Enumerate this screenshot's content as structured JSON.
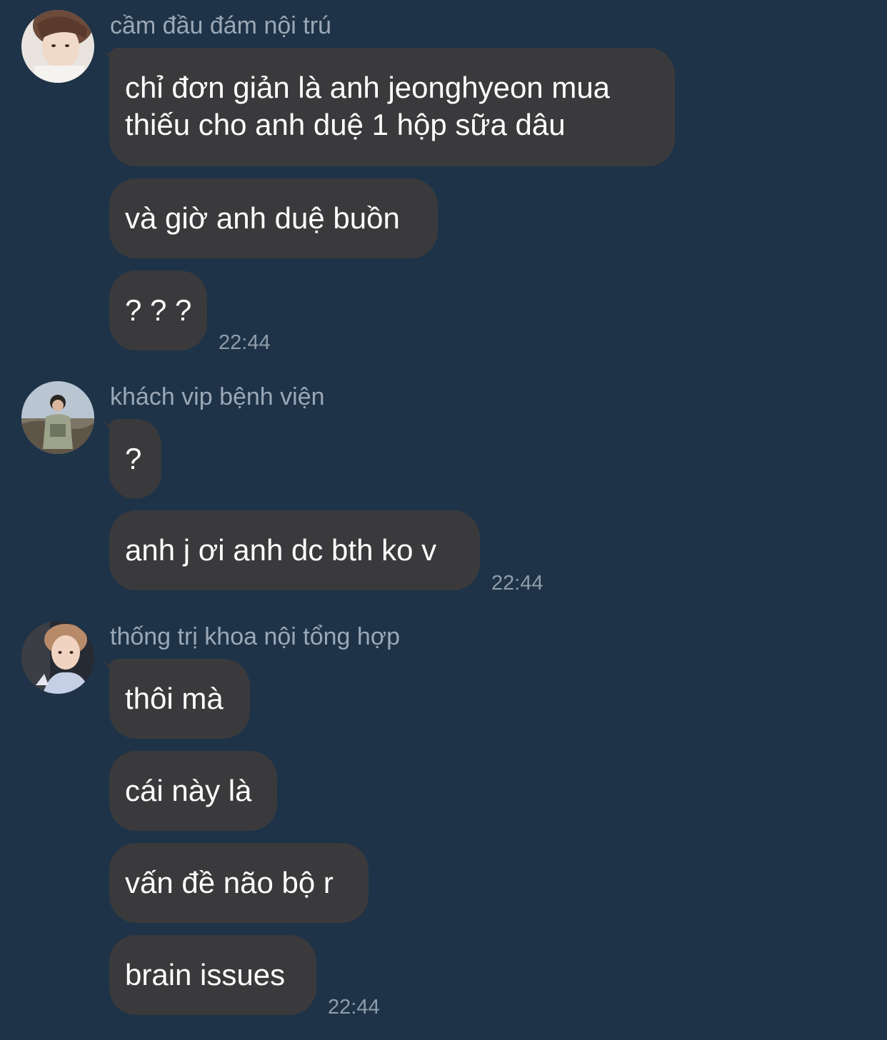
{
  "groups": [
    {
      "sender": "cầm đầu đám nội trú",
      "avatar_icon": "user-avatar-1",
      "messages": [
        "chỉ đơn giản là anh jeonghyeon mua\nthiếu cho anh duệ 1 hộp sữa dâu",
        "và giờ anh duệ buồn",
        "? ? ?"
      ],
      "time": "22:44"
    },
    {
      "sender": "khách vip bệnh viện",
      "avatar_icon": "user-avatar-2",
      "messages": [
        "?",
        "anh j ơi anh dc bth ko v"
      ],
      "time": "22:44"
    },
    {
      "sender": "thống trị khoa nội tổng hợp",
      "avatar_icon": "user-avatar-3",
      "messages": [
        "thôi mà",
        "cái này là",
        "vấn đề não bộ r",
        "brain issues"
      ],
      "time": "22:44"
    }
  ],
  "colors": {
    "background": "#1e3347",
    "bubble": "#3a3a3c",
    "sender_text": "#9aa8b7",
    "time_text": "#8f9dab"
  }
}
